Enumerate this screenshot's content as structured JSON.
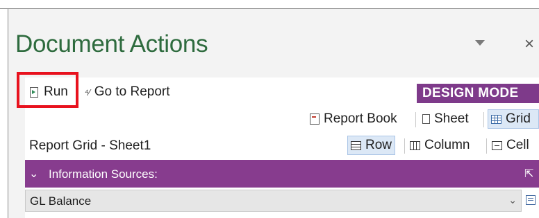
{
  "pane": {
    "title": "Document Actions",
    "dropdown_icon": "chevron-down-icon",
    "close_icon": "close-icon",
    "close_glyph": "×"
  },
  "toolbar": {
    "run_label": "Run",
    "goto_report_label": "Go to Report",
    "mode_label": "DESIGN MODE",
    "mode_color": "#7e3a8a",
    "highlight_color": "#e8121e"
  },
  "view_toolbar": {
    "report_book_label": "Report Book",
    "sheet_label": "Sheet",
    "grid_label": "Grid",
    "selected": "Grid"
  },
  "report_grid": {
    "title": "Report Grid - Sheet1",
    "row_label": "Row",
    "column_label": "Column",
    "cell_label": "Cell",
    "selected": "Row"
  },
  "info_sources": {
    "label": "Information Sources:",
    "expand_glyph": "⌄",
    "pin_glyph": "⇱",
    "bar_color": "#873c8e"
  },
  "source_select": {
    "value": "GL Balance",
    "arrow_glyph": "⌄"
  }
}
